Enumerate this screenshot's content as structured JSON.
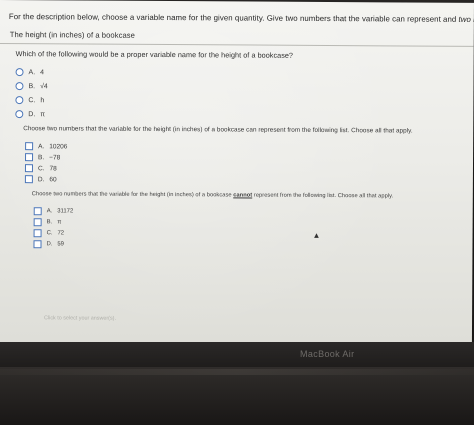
{
  "header": {
    "instruction_prefix": "For the description below, choose a variable name for the given quantity. Give two numbers that the variable can represent and ",
    "instruction_italic": "two numbers that it cannot represent",
    "subtitle": "The height (in inches) of a bookcase"
  },
  "question1": {
    "prompt": "Which of the following would be a proper variable name for the height of a bookcase?",
    "options": [
      {
        "key": "A.",
        "text": "4"
      },
      {
        "key": "B.",
        "text": "√4"
      },
      {
        "key": "C.",
        "text": "h"
      },
      {
        "key": "D.",
        "text": "π"
      }
    ]
  },
  "question2": {
    "prompt": "Choose two numbers that the variable for the height (in inches) of a bookcase can represent from the following list. Choose all that apply.",
    "options": [
      {
        "key": "A.",
        "text": "10206"
      },
      {
        "key": "B.",
        "text": "−78"
      },
      {
        "key": "C.",
        "text": "78"
      },
      {
        "key": "D.",
        "text": "60"
      }
    ]
  },
  "question3": {
    "prompt_prefix": "Choose two numbers that the variable for the height (in inches) of a bookcase ",
    "prompt_strong": "cannot",
    "prompt_suffix": " represent from the following list. Choose all that apply.",
    "options": [
      {
        "key": "A.",
        "text": "31172"
      },
      {
        "key": "B.",
        "text": "π"
      },
      {
        "key": "C.",
        "text": "72"
      },
      {
        "key": "D.",
        "text": "59"
      }
    ]
  },
  "footer": {
    "hint": "Click to select your answer(s).",
    "brand": "MacBook Air"
  }
}
